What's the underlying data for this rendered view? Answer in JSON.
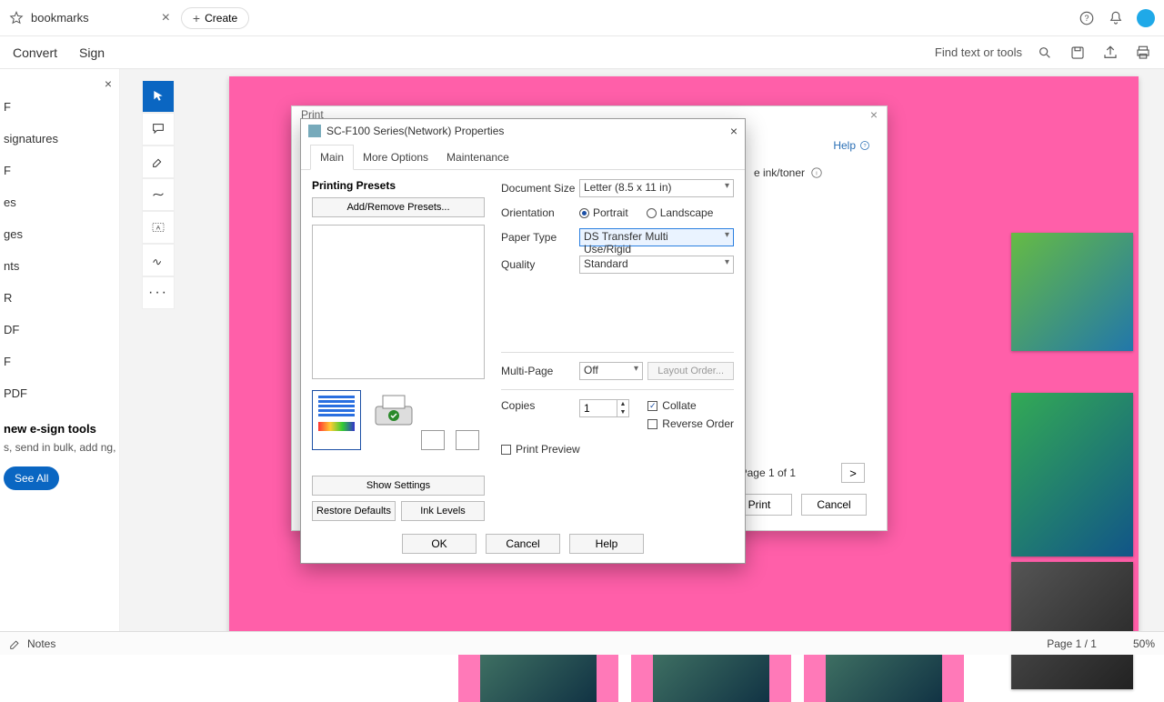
{
  "titlebar": {
    "tab_name": "bookmarks",
    "create_label": "Create"
  },
  "menubar": {
    "items": [
      "Convert",
      "Sign"
    ],
    "find_label": "Find text or tools"
  },
  "leftpanel": {
    "items": [
      "F",
      "signatures",
      "F",
      "es",
      "ges",
      "nts",
      "R",
      "DF",
      "F",
      "PDF"
    ],
    "promo_title": "new e-sign tools",
    "promo_desc": "s, send in bulk, add ng, and more.",
    "see_all": "See All"
  },
  "print_dialog": {
    "title": "Print",
    "help_label": "Help",
    "ink_label": "e ink/toner",
    "page_info": "Page 1 of 1",
    "nav_next": ">",
    "print_btn": "Print",
    "cancel_btn": "Cancel"
  },
  "properties": {
    "window_title": "SC-F100 Series(Network) Properties",
    "tabs": {
      "main": "Main",
      "more": "More Options",
      "maint": "Maintenance"
    },
    "presets_title": "Printing Presets",
    "add_remove": "Add/Remove Presets...",
    "show_settings": "Show Settings",
    "restore_defaults": "Restore Defaults",
    "ink_levels": "Ink Levels",
    "labels": {
      "doc_size": "Document Size",
      "orientation": "Orientation",
      "paper_type": "Paper Type",
      "quality": "Quality",
      "multi_page": "Multi-Page",
      "copies": "Copies",
      "layout_order": "Layout Order...",
      "collate": "Collate",
      "reverse": "Reverse Order",
      "print_preview": "Print Preview"
    },
    "values": {
      "doc_size": "Letter (8.5 x 11 in)",
      "portrait": "Portrait",
      "landscape": "Landscape",
      "paper_type": "DS Transfer Multi Use/Rigid",
      "quality": "Standard",
      "multi_page": "Off",
      "copies": "1"
    },
    "footer": {
      "ok": "OK",
      "cancel": "Cancel",
      "help": "Help"
    }
  },
  "statusbar": {
    "notes": "Notes",
    "page": "Page 1 / 1",
    "zoom": "50%"
  }
}
